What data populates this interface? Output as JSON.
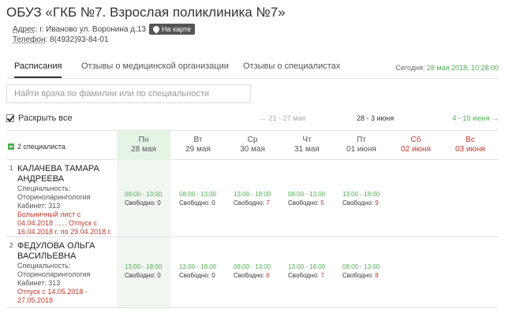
{
  "org": {
    "title": "ОБУЗ «ГКБ №7. Взрослая поликлиника №7»",
    "address_label": "Адрес",
    "address": ": г. Иваново ул. Воронина д.13",
    "map_button": "На карте",
    "phone_label": "Телефон",
    "phone": ": 8(4932)93-84-01"
  },
  "tabs": [
    {
      "label": "Расписания",
      "active": true
    },
    {
      "label": "Отзывы о медицинской организации",
      "active": false
    },
    {
      "label": "Отзывы о специалистах",
      "active": false
    }
  ],
  "today": {
    "label": "Сегодня: ",
    "value": "28 мая 2018, 10:28:00"
  },
  "search": {
    "placeholder": "Найти врача по фамилии или по специальности"
  },
  "expand_all": "Раскрыть все",
  "weeks": {
    "prev": "← 21 - 27 мая",
    "current": "28 - 3 июня",
    "next": "4 - 10 июня →"
  },
  "specialists_count": "2 специалиста",
  "days": [
    {
      "dow": "Пн",
      "date": "28 мая",
      "weekend": false,
      "selected": true
    },
    {
      "dow": "Вт",
      "date": "29 мая",
      "weekend": false,
      "selected": false
    },
    {
      "dow": "Ср",
      "date": "30 мая",
      "weekend": false,
      "selected": false
    },
    {
      "dow": "Чт",
      "date": "31 мая",
      "weekend": false,
      "selected": false
    },
    {
      "dow": "Пт",
      "date": "01 июня",
      "weekend": false,
      "selected": false
    },
    {
      "dow": "Сб",
      "date": "02 июня",
      "weekend": true,
      "selected": false
    },
    {
      "dow": "Вс",
      "date": "03 июня",
      "weekend": true,
      "selected": false
    }
  ],
  "free_label": "Свободно: ",
  "doctors": [
    {
      "num": "1",
      "name1": "КАЛАЧЕВА ТАМАРА",
      "name2": "АНДРЕЕВА",
      "spec_label": "Специальность:",
      "spec": "Оториноларингология",
      "cabinet": "Кабинет: 313",
      "note1": "Больничный лист с",
      "note2": "04.04.2018 ...... Отпуск с",
      "note3": "16.04.2018 г. по 29.04.2018 г.",
      "slots": [
        {
          "time": "08:00 - 13:00",
          "free": "0"
        },
        {
          "time": "08:00 - 13:00",
          "free": "0"
        },
        {
          "time": "13:00 - 18:00",
          "free": "7"
        },
        {
          "time": "08:00 - 13:00",
          "free": "5"
        },
        {
          "time": "13:00 - 18:00",
          "free": "9"
        }
      ]
    },
    {
      "num": "2",
      "name1": "ФЕДУЛОВА ОЛЬГА",
      "name2": "ВАСИЛЬЕВНА",
      "spec_label": "Специальность:",
      "spec": "Оториноларингология",
      "cabinet": "Кабинет: 313",
      "note1": "Отпуск с 14.05.2018 -",
      "note2": "27.05.2018",
      "slots": [
        {
          "time": "13:00 - 18:00",
          "free": "0"
        },
        {
          "time": "13:00 - 18:00",
          "free": "0"
        },
        {
          "time": "08:00 - 13:00",
          "free": "6"
        },
        {
          "time": "13:00 - 18:00",
          "free": "7"
        },
        {
          "time": "08:00 - 13:00",
          "free": "8"
        }
      ]
    }
  ]
}
